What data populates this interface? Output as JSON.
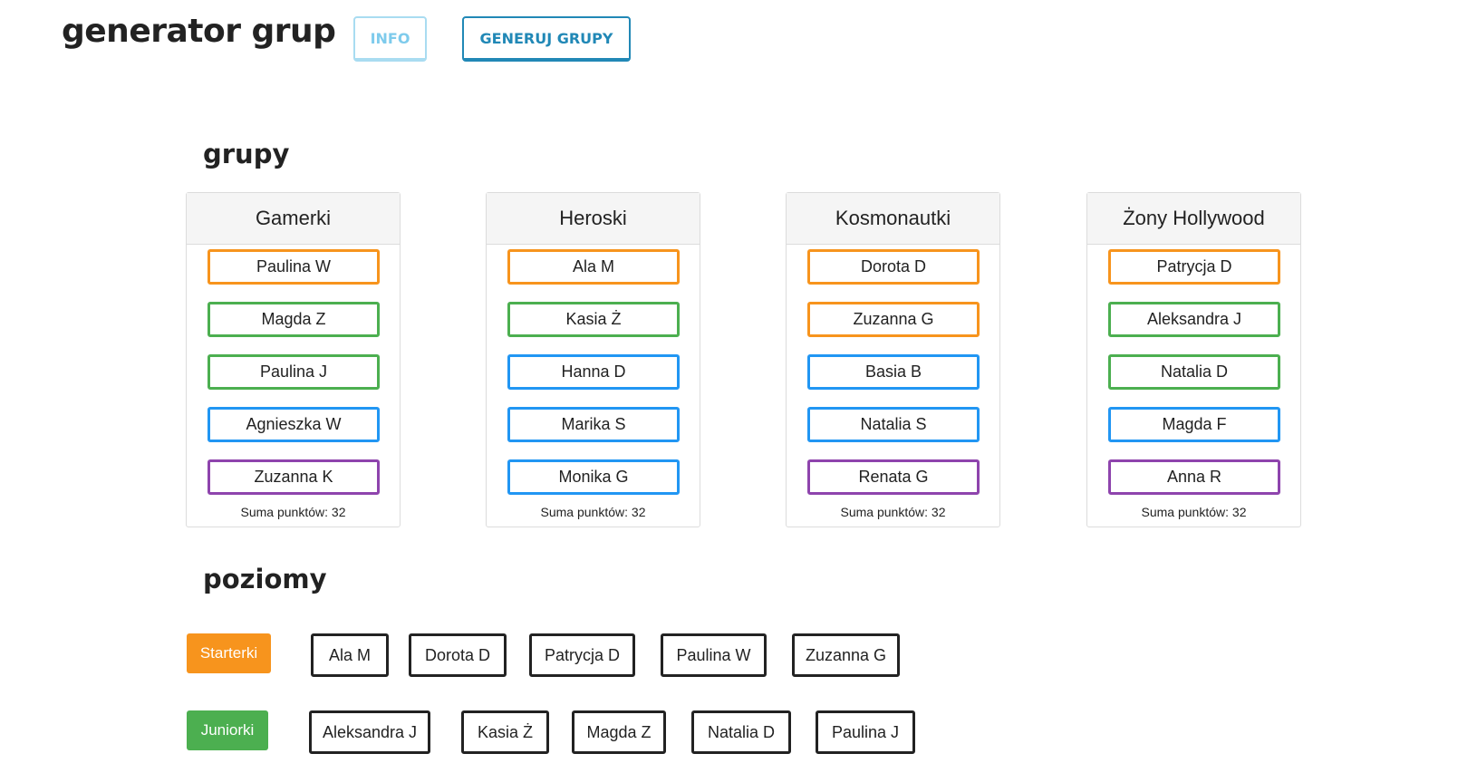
{
  "header": {
    "logo": "generator grup",
    "nav": [
      {
        "label": "INFO"
      },
      {
        "label": "GENERUJ GRUPY"
      }
    ]
  },
  "colors": {
    "starterki": "#f7941d",
    "juniorki": "#4caf50",
    "blue_level": "#2196f3",
    "purple_level": "#8e44ad",
    "nav_info": "#7ecbec",
    "nav_generate": "#2188b6"
  },
  "groups_section": {
    "title": "grupy",
    "groups": [
      {
        "name": "Gamerki",
        "members": [
          {
            "name": "Paulina W",
            "level": "orange"
          },
          {
            "name": "Magda Z",
            "level": "green"
          },
          {
            "name": "Paulina J",
            "level": "green"
          },
          {
            "name": "Agnieszka W",
            "level": "blue"
          },
          {
            "name": "Zuzanna K",
            "level": "purple"
          }
        ],
        "sum": "Suma punktów: 32"
      },
      {
        "name": "Heroski",
        "members": [
          {
            "name": "Ala M",
            "level": "orange"
          },
          {
            "name": "Kasia Ż",
            "level": "green"
          },
          {
            "name": "Hanna D",
            "level": "blue"
          },
          {
            "name": "Marika S",
            "level": "blue"
          },
          {
            "name": "Monika G",
            "level": "blue"
          }
        ],
        "sum": "Suma punktów: 32"
      },
      {
        "name": "Kosmonautki",
        "members": [
          {
            "name": "Dorota D",
            "level": "orange"
          },
          {
            "name": "Zuzanna G",
            "level": "orange"
          },
          {
            "name": "Basia B",
            "level": "blue"
          },
          {
            "name": "Natalia S",
            "level": "blue"
          },
          {
            "name": "Renata G",
            "level": "purple"
          }
        ],
        "sum": "Suma punktów: 32"
      },
      {
        "name": "Żony Hollywood",
        "members": [
          {
            "name": "Patrycja D",
            "level": "orange"
          },
          {
            "name": "Aleksandra J",
            "level": "green"
          },
          {
            "name": "Natalia D",
            "level": "green"
          },
          {
            "name": "Magda F",
            "level": "blue"
          },
          {
            "name": "Anna R",
            "level": "purple"
          }
        ],
        "sum": "Suma punktów: 32"
      }
    ]
  },
  "levels_section": {
    "title": "poziomy",
    "levels": [
      {
        "label": "Starterki",
        "color": "orange",
        "members": [
          "Ala M",
          "Dorota D",
          "Patrycja D",
          "Paulina W",
          "Zuzanna G"
        ]
      },
      {
        "label": "Juniorki",
        "color": "green",
        "members": [
          "Aleksandra J",
          "Kasia Ż",
          "Magda Z",
          "Natalia D",
          "Paulina J"
        ]
      }
    ]
  }
}
